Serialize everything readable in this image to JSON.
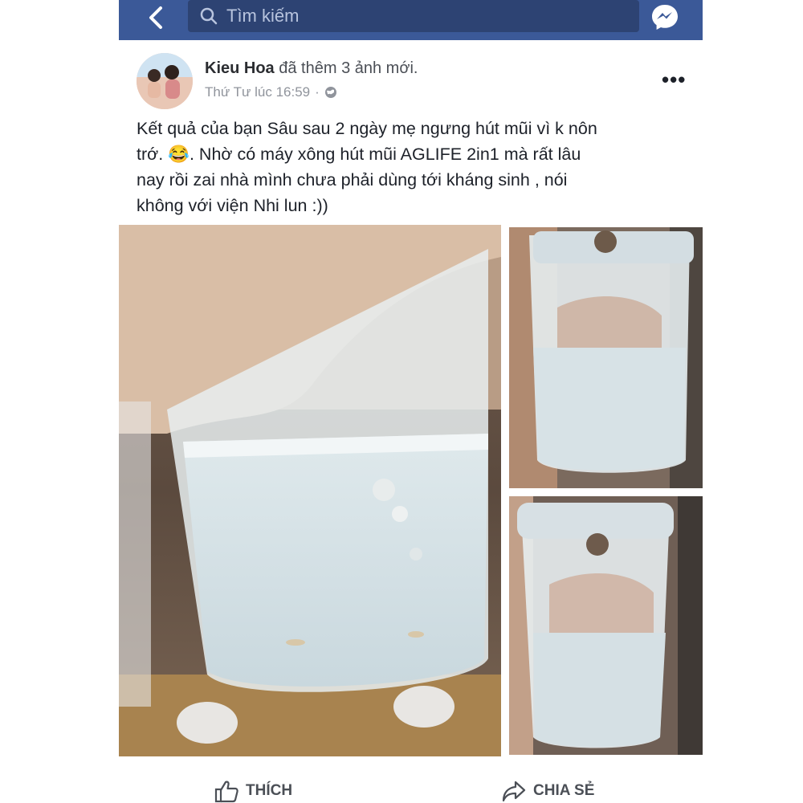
{
  "topbar": {
    "search_placeholder": "Tìm kiếm"
  },
  "post": {
    "author": "Kieu Hoa",
    "action": "đã thêm 3 ảnh mới.",
    "timestamp": "Thứ Tư lúc 16:59",
    "separator": "·",
    "more_label": "•••",
    "text_line1": "Kết quả của bạn Sâu sau 2 ngày mẹ ngưng hút mũi vì k nôn",
    "text_line2a": "trớ.",
    "text_line2b": ".   Nhờ có máy xông hút mũi AGLIFE 2in1 mà rất lâu",
    "text_line3": "nay rồi zai nhà mình chưa phải dùng tới kháng sinh , nói",
    "text_line4": "không với viện Nhi lun :))",
    "emoji": "😂"
  },
  "actions": {
    "like_label": "THÍCH",
    "share_label": "CHIA SẺ"
  },
  "colors": {
    "header_blue": "#3b5998",
    "search_bg": "#2d4373"
  },
  "icons": [
    "back-arrow-icon",
    "search-icon",
    "messenger-icon",
    "globe-icon",
    "like-icon",
    "share-icon"
  ]
}
